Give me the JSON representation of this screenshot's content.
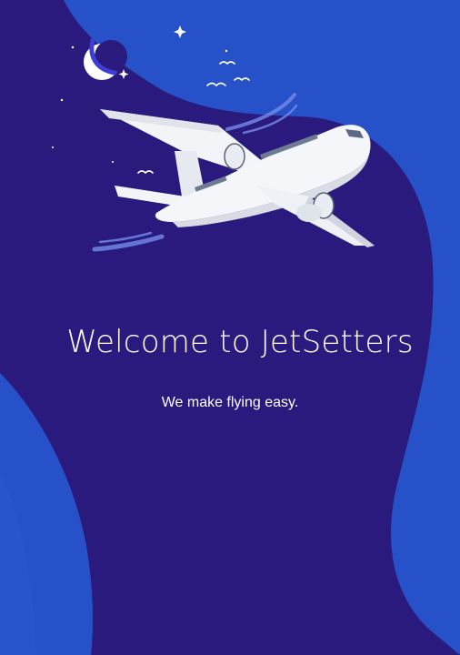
{
  "welcome": {
    "title": "Welcome to JetSetters",
    "subtitle": "We make flying easy."
  },
  "theme": {
    "background": "#2a1a7e",
    "accent_blob": "#2651c8",
    "text": "#ffffff"
  },
  "illustration": {
    "main": "airplane-illustration",
    "decor": [
      "moon-icon",
      "sparkle-icon",
      "bird-icon"
    ]
  }
}
